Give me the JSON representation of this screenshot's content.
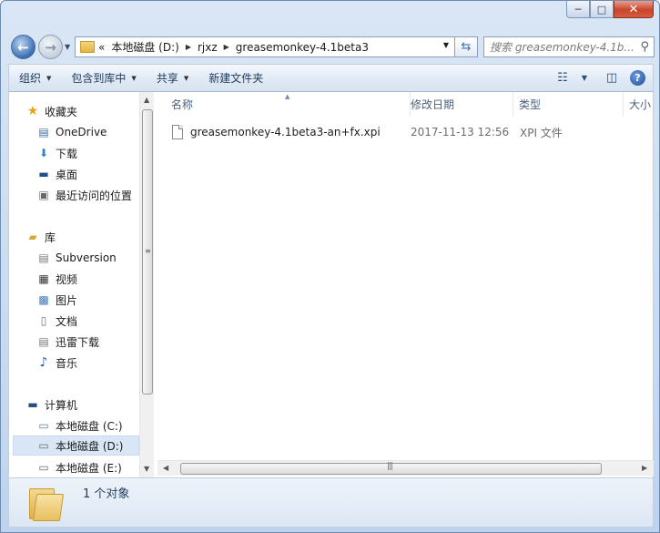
{
  "window": {
    "caption": {
      "minimize": "─",
      "maximize": "□",
      "close": "✕"
    }
  },
  "nav": {
    "back_icon": "←",
    "forward_icon": "→",
    "address": {
      "overflow": "«",
      "crumbs": [
        "本地磁盘 (D:)",
        "rjxz",
        "greasemonkey-4.1beta3"
      ]
    },
    "search": {
      "placeholder": "搜索 greasemonkey-4.1b..."
    }
  },
  "toolbar": {
    "organize": "组织",
    "include_in_library": "包含到库中",
    "share": "共享",
    "new_folder": "新建文件夹"
  },
  "sidebar": {
    "favorites": {
      "header": "收藏夹",
      "items": [
        "OneDrive",
        "下载",
        "桌面",
        "最近访问的位置"
      ]
    },
    "libraries": {
      "header": "库",
      "items": [
        "Subversion",
        "视频",
        "图片",
        "文档",
        "迅雷下载",
        "音乐"
      ]
    },
    "computer": {
      "header": "计算机",
      "items": [
        "本地磁盘 (C:)",
        "本地磁盘 (D:)",
        "本地磁盘 (E:)"
      ],
      "selected": "本地磁盘 (D:)"
    }
  },
  "file_list": {
    "columns": [
      "名称",
      "修改日期",
      "类型",
      "大小"
    ],
    "rows": [
      {
        "name": "greasemonkey-4.1beta3-an+fx.xpi",
        "modified": "2017-11-13 12:56",
        "type": "XPI 文件"
      }
    ]
  },
  "details": {
    "count": "1 个对象"
  }
}
